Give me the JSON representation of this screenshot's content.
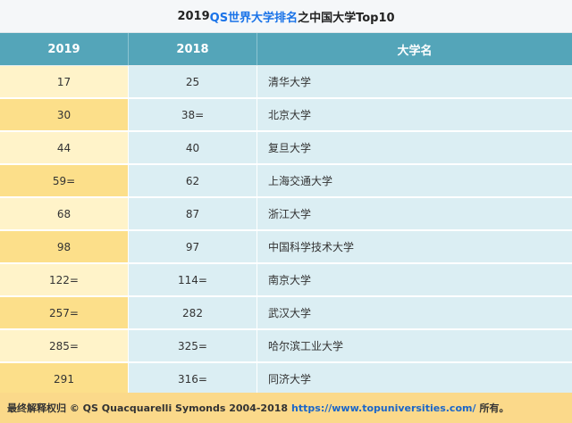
{
  "title": {
    "prefix": "2019 ",
    "highlight": "QS世界大学排名",
    "suffix": "之中国大学Top10"
  },
  "header": {
    "col1": "2019",
    "col2": "2018",
    "col3": "大学名"
  },
  "rows": [
    {
      "r2019": "17",
      "r2018": "25",
      "name": "清华大学"
    },
    {
      "r2019": "30",
      "r2018": "38=",
      "name": "北京大学"
    },
    {
      "r2019": "44",
      "r2018": "40",
      "name": "复旦大学"
    },
    {
      "r2019": "59=",
      "r2018": "62",
      "name": "上海交通大学"
    },
    {
      "r2019": "68",
      "r2018": "87",
      "name": "浙江大学"
    },
    {
      "r2019": "98",
      "r2018": "97",
      "name": "中国科学技术大学"
    },
    {
      "r2019": "122=",
      "r2018": "114=",
      "name": "南京大学"
    },
    {
      "r2019": "257=",
      "r2018": "282",
      "name": "武汉大学"
    },
    {
      "r2019": "285=",
      "r2018": "325=",
      "name": "哈尔滨工业大学"
    },
    {
      "r2019": "291",
      "r2018": "316=",
      "name": "同济大学"
    }
  ],
  "footer": {
    "prefix": "最终解释权归 © QS Quacquarelli Symonds 2004-2018",
    "link": "https://www.topuniversities.com/",
    "suffix": "所有。"
  },
  "colors": {
    "header_teal": "#54a5b9",
    "col2019_light": "#fff3c9",
    "col2019_dark": "#fcdf8a",
    "col_blue": "#dbeef3",
    "footer_bg": "#fbd98a",
    "link": "#1a66c9"
  }
}
